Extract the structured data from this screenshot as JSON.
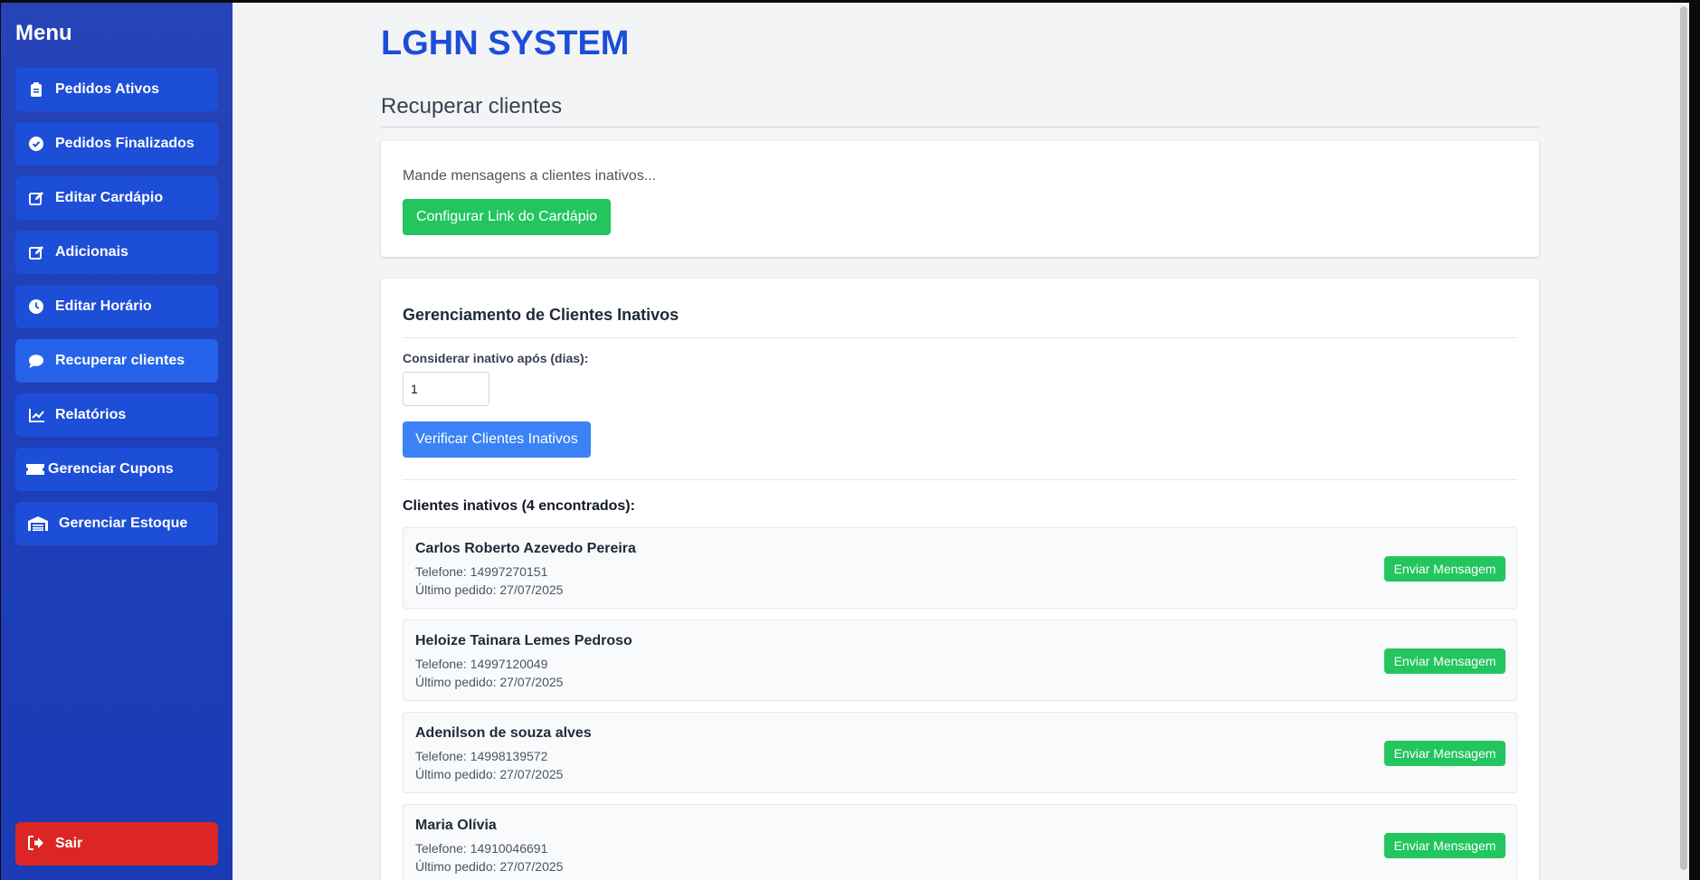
{
  "sidebar": {
    "title": "Menu",
    "items": [
      {
        "label": "Pedidos Ativos",
        "icon": "clipboard-icon"
      },
      {
        "label": "Pedidos Finalizados",
        "icon": "check-circle-icon"
      },
      {
        "label": "Editar Cardápio",
        "icon": "edit-icon"
      },
      {
        "label": "Adicionais",
        "icon": "edit-icon"
      },
      {
        "label": "Editar Horário",
        "icon": "clock-icon"
      },
      {
        "label": "Recuperar clientes",
        "icon": "chat-bubble-icon"
      },
      {
        "label": "Relatórios",
        "icon": "line-chart-icon"
      },
      {
        "label": "Gerenciar Cupons",
        "icon": "ticket-icon"
      },
      {
        "label": "Gerenciar Estoque",
        "icon": "warehouse-icon"
      }
    ],
    "active_index": 5,
    "logout_label": "Sair"
  },
  "header": {
    "brand": "LGHN SYSTEM"
  },
  "page": {
    "title": "Recuperar clientes",
    "intro_text": "Mande mensagens a clientes inativos...",
    "config_button": "Configurar Link do Cardápio"
  },
  "inactive": {
    "title": "Gerenciamento de Clientes Inativos",
    "days_label": "Considerar inativo após (dias):",
    "days_value": "1",
    "verify_button": "Verificar Clientes Inativos",
    "found_label": "Clientes inativos (4 encontrados):",
    "send_button": "Enviar Mensagem",
    "clients": [
      {
        "name": "Carlos Roberto Azevedo Pereira",
        "phone": "Telefone: 14997270151",
        "last_order": "Último pedido: 27/07/2025"
      },
      {
        "name": "Heloize Tainara Lemes Pedroso",
        "phone": "Telefone: 14997120049",
        "last_order": "Último pedido: 27/07/2025"
      },
      {
        "name": "Adenilson de souza alves",
        "phone": "Telefone: 14998139572",
        "last_order": "Último pedido: 27/07/2025"
      },
      {
        "name": "Maria Olívia",
        "phone": "Telefone: 14910046691",
        "last_order": "Último pedido: 27/07/2025"
      }
    ]
  },
  "colors": {
    "sidebar_bg": "#1e3fb8",
    "nav_item": "#1d4ed8",
    "nav_active": "#2563eb",
    "brand": "#1d4ed8",
    "green": "#22c55e",
    "blue": "#3b82f6",
    "red": "#dc2626"
  }
}
